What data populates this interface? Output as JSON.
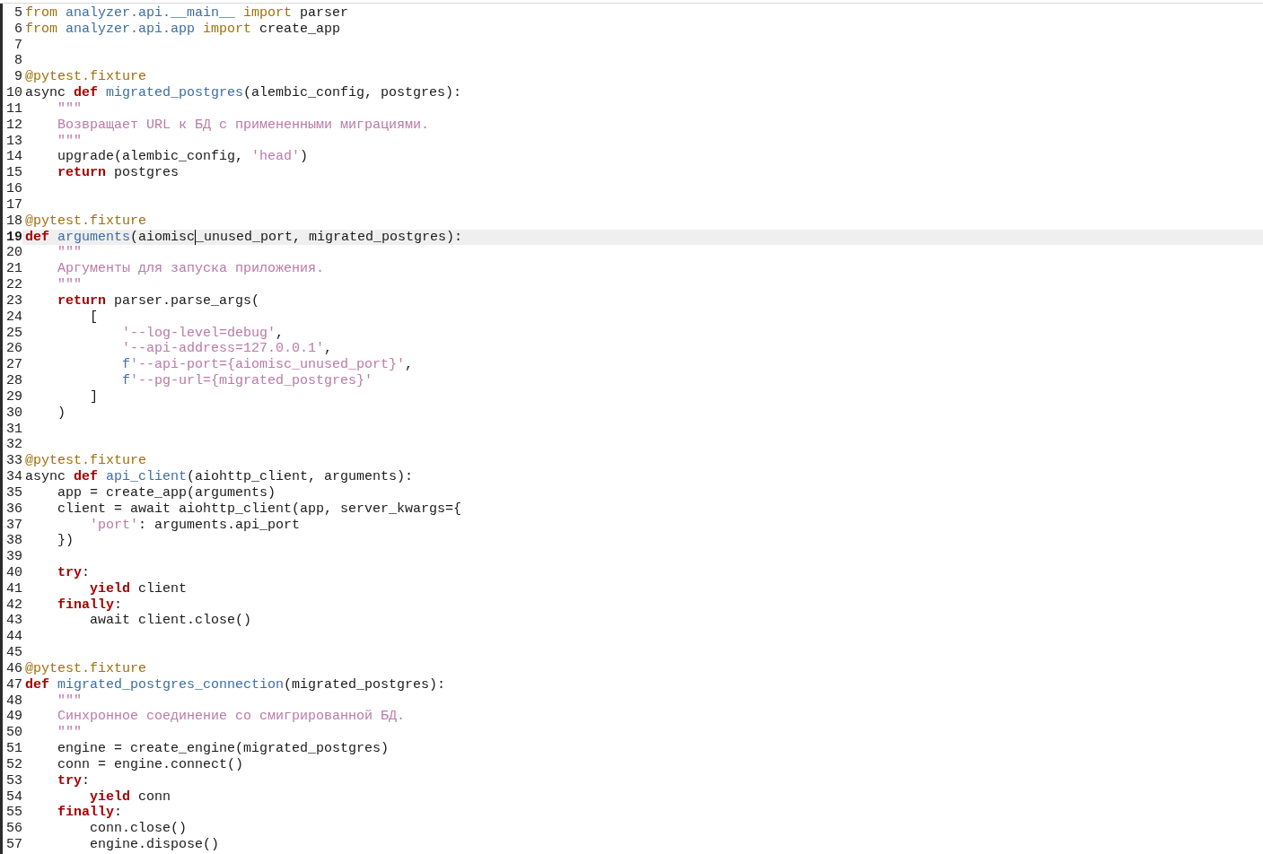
{
  "lines": [
    {
      "number": "5",
      "current": false,
      "tokens": [
        {
          "kind": "import",
          "text": "from "
        },
        {
          "kind": "module",
          "text": "analyzer.api.__main__ "
        },
        {
          "kind": "import",
          "text": "import"
        },
        {
          "kind": "plain",
          "text": " parser"
        }
      ]
    },
    {
      "number": "6",
      "current": false,
      "tokens": [
        {
          "kind": "import",
          "text": "from "
        },
        {
          "kind": "module",
          "text": "analyzer.api.app "
        },
        {
          "kind": "import",
          "text": "import"
        },
        {
          "kind": "plain",
          "text": " create_app"
        }
      ]
    },
    {
      "number": "7",
      "current": false
    },
    {
      "number": "8",
      "current": false
    },
    {
      "number": "9",
      "current": false,
      "tokens": [
        {
          "kind": "decorator",
          "text": "@pytest.fixture"
        }
      ]
    },
    {
      "number": "10",
      "current": false,
      "tokens": [
        {
          "kind": "plain",
          "text": "async "
        },
        {
          "kind": "keyword",
          "text": "def "
        },
        {
          "kind": "function",
          "text": "migrated_postgres"
        },
        {
          "kind": "plain",
          "text": "(alembic_config, postgres):"
        }
      ]
    },
    {
      "number": "11",
      "current": false,
      "tokens": [
        {
          "kind": "docstring",
          "text": "    \"\"\""
        }
      ]
    },
    {
      "number": "12",
      "current": false,
      "tokens": [
        {
          "kind": "docstring",
          "text": "    Возвращает URL к БД с примененными миграциями."
        }
      ]
    },
    {
      "number": "13",
      "current": false,
      "tokens": [
        {
          "kind": "docstring",
          "text": "    \"\"\""
        }
      ]
    },
    {
      "number": "14",
      "current": false,
      "tokens": [
        {
          "kind": "plain",
          "text": "    upgrade(alembic_config, "
        },
        {
          "kind": "string",
          "text": "'head'"
        },
        {
          "kind": "plain",
          "text": ")"
        }
      ]
    },
    {
      "number": "15",
      "current": false,
      "tokens": [
        {
          "kind": "keyword",
          "text": "    return"
        },
        {
          "kind": "plain",
          "text": " postgres"
        }
      ]
    },
    {
      "number": "16",
      "current": false
    },
    {
      "number": "17",
      "current": false
    },
    {
      "number": "18",
      "current": false,
      "tokens": [
        {
          "kind": "decorator",
          "text": "@pytest.fixture"
        }
      ]
    },
    {
      "number": "19",
      "current": true,
      "tokens": [
        {
          "kind": "keyword",
          "text": "def "
        },
        {
          "kind": "function",
          "text": "arguments"
        },
        {
          "kind": "plain",
          "text": "(aiomisc"
        },
        {
          "kind": "plain",
          "text": "_unused_port, migrated_postgres):",
          "caret": true
        }
      ]
    },
    {
      "number": "20",
      "current": false,
      "tokens": [
        {
          "kind": "docstring",
          "text": "    \"\"\""
        }
      ]
    },
    {
      "number": "21",
      "current": false,
      "tokens": [
        {
          "kind": "docstring",
          "text": "    Аргументы для запуска приложения."
        }
      ]
    },
    {
      "number": "22",
      "current": false,
      "tokens": [
        {
          "kind": "docstring",
          "text": "    \"\"\""
        }
      ]
    },
    {
      "number": "23",
      "current": false,
      "tokens": [
        {
          "kind": "keyword",
          "text": "    return"
        },
        {
          "kind": "plain",
          "text": " parser.parse_args("
        }
      ]
    },
    {
      "number": "24",
      "current": false,
      "tokens": [
        {
          "kind": "plain",
          "text": "        ["
        }
      ]
    },
    {
      "number": "25",
      "current": false,
      "tokens": [
        {
          "kind": "string",
          "text": "            '--log-level=debug'"
        },
        {
          "kind": "plain",
          "text": ","
        }
      ]
    },
    {
      "number": "26",
      "current": false,
      "tokens": [
        {
          "kind": "string",
          "text": "            '--api-address=127.0.0.1'"
        },
        {
          "kind": "plain",
          "text": ","
        }
      ]
    },
    {
      "number": "27",
      "current": false,
      "tokens": [
        {
          "kind": "prefix",
          "text": "            f"
        },
        {
          "kind": "string",
          "text": "'--api-port={aiomisc_unused_port}'"
        },
        {
          "kind": "plain",
          "text": ","
        }
      ]
    },
    {
      "number": "28",
      "current": false,
      "tokens": [
        {
          "kind": "prefix",
          "text": "            f"
        },
        {
          "kind": "string",
          "text": "'--pg-url={migrated_postgres}'"
        }
      ]
    },
    {
      "number": "29",
      "current": false,
      "tokens": [
        {
          "kind": "plain",
          "text": "        ]"
        }
      ]
    },
    {
      "number": "30",
      "current": false,
      "tokens": [
        {
          "kind": "plain",
          "text": "    )"
        }
      ]
    },
    {
      "number": "31",
      "current": false
    },
    {
      "number": "32",
      "current": false
    },
    {
      "number": "33",
      "current": false,
      "tokens": [
        {
          "kind": "decorator",
          "text": "@pytest.fixture"
        }
      ]
    },
    {
      "number": "34",
      "current": false,
      "tokens": [
        {
          "kind": "plain",
          "text": "async "
        },
        {
          "kind": "keyword",
          "text": "def "
        },
        {
          "kind": "function",
          "text": "api_client"
        },
        {
          "kind": "plain",
          "text": "(aiohttp_client, arguments):"
        }
      ]
    },
    {
      "number": "35",
      "current": false,
      "tokens": [
        {
          "kind": "plain",
          "text": "    app = create_app(arguments)"
        }
      ]
    },
    {
      "number": "36",
      "current": false,
      "tokens": [
        {
          "kind": "plain",
          "text": "    client = await aiohttp_client(app, server_kwargs={"
        }
      ]
    },
    {
      "number": "37",
      "current": false,
      "tokens": [
        {
          "kind": "string",
          "text": "        'port'"
        },
        {
          "kind": "plain",
          "text": ": arguments.api_port"
        }
      ]
    },
    {
      "number": "38",
      "current": false,
      "tokens": [
        {
          "kind": "plain",
          "text": "    })"
        }
      ]
    },
    {
      "number": "39",
      "current": false
    },
    {
      "number": "40",
      "current": false,
      "tokens": [
        {
          "kind": "keyword",
          "text": "    try"
        },
        {
          "kind": "plain",
          "text": ":"
        }
      ]
    },
    {
      "number": "41",
      "current": false,
      "tokens": [
        {
          "kind": "keyword",
          "text": "        yield"
        },
        {
          "kind": "plain",
          "text": " client"
        }
      ]
    },
    {
      "number": "42",
      "current": false,
      "tokens": [
        {
          "kind": "keyword",
          "text": "    finally"
        },
        {
          "kind": "plain",
          "text": ":"
        }
      ]
    },
    {
      "number": "43",
      "current": false,
      "tokens": [
        {
          "kind": "plain",
          "text": "        await client.close()"
        }
      ]
    },
    {
      "number": "44",
      "current": false
    },
    {
      "number": "45",
      "current": false
    },
    {
      "number": "46",
      "current": false,
      "tokens": [
        {
          "kind": "decorator",
          "text": "@pytest.fixture"
        }
      ]
    },
    {
      "number": "47",
      "current": false,
      "tokens": [
        {
          "kind": "keyword",
          "text": "def "
        },
        {
          "kind": "function",
          "text": "migrated_postgres_connection"
        },
        {
          "kind": "plain",
          "text": "(migrated_postgres):"
        }
      ]
    },
    {
      "number": "48",
      "current": false,
      "tokens": [
        {
          "kind": "docstring",
          "text": "    \"\"\""
        }
      ]
    },
    {
      "number": "49",
      "current": false,
      "tokens": [
        {
          "kind": "docstring",
          "text": "    Синхронное соединение со смигрированной БД."
        }
      ]
    },
    {
      "number": "50",
      "current": false,
      "tokens": [
        {
          "kind": "docstring",
          "text": "    \"\"\""
        }
      ]
    },
    {
      "number": "51",
      "current": false,
      "tokens": [
        {
          "kind": "plain",
          "text": "    engine = create_engine(migrated_postgres)"
        }
      ]
    },
    {
      "number": "52",
      "current": false,
      "tokens": [
        {
          "kind": "plain",
          "text": "    conn = engine.connect()"
        }
      ]
    },
    {
      "number": "53",
      "current": false,
      "tokens": [
        {
          "kind": "keyword",
          "text": "    try"
        },
        {
          "kind": "plain",
          "text": ":"
        }
      ]
    },
    {
      "number": "54",
      "current": false,
      "tokens": [
        {
          "kind": "keyword",
          "text": "        yield"
        },
        {
          "kind": "plain",
          "text": " conn"
        }
      ]
    },
    {
      "number": "55",
      "current": false,
      "tokens": [
        {
          "kind": "keyword",
          "text": "    finally"
        },
        {
          "kind": "plain",
          "text": ":"
        }
      ]
    },
    {
      "number": "56",
      "current": false,
      "tokens": [
        {
          "kind": "plain",
          "text": "        conn.close()"
        }
      ]
    },
    {
      "number": "57",
      "current": false,
      "tokens": [
        {
          "kind": "plain",
          "text": "        engine.dispose()"
        }
      ]
    }
  ]
}
